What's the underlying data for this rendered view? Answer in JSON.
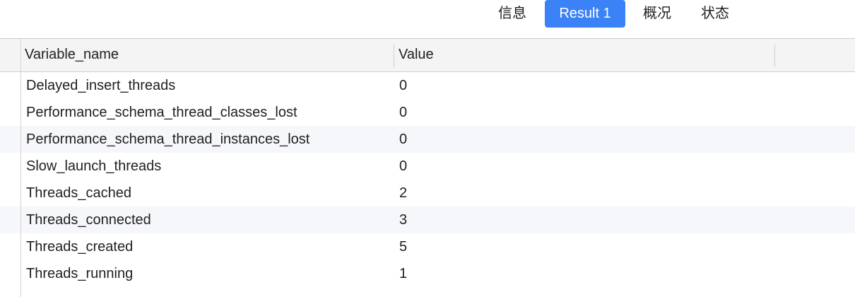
{
  "tabs": [
    {
      "label": "信息",
      "active": false
    },
    {
      "label": "Result 1",
      "active": true
    },
    {
      "label": "概况",
      "active": false
    },
    {
      "label": "状态",
      "active": false
    }
  ],
  "accent_color": "#3b82f6",
  "table": {
    "columns": [
      "Variable_name",
      "Value"
    ],
    "rows": [
      {
        "name": "Delayed_insert_threads",
        "value": "0"
      },
      {
        "name": "Performance_schema_thread_classes_lost",
        "value": "0"
      },
      {
        "name": "Performance_schema_thread_instances_lost",
        "value": "0"
      },
      {
        "name": "Slow_launch_threads",
        "value": "0"
      },
      {
        "name": "Threads_cached",
        "value": "2"
      },
      {
        "name": "Threads_connected",
        "value": "3"
      },
      {
        "name": "Threads_created",
        "value": "5"
      },
      {
        "name": "Threads_running",
        "value": "1"
      }
    ]
  }
}
